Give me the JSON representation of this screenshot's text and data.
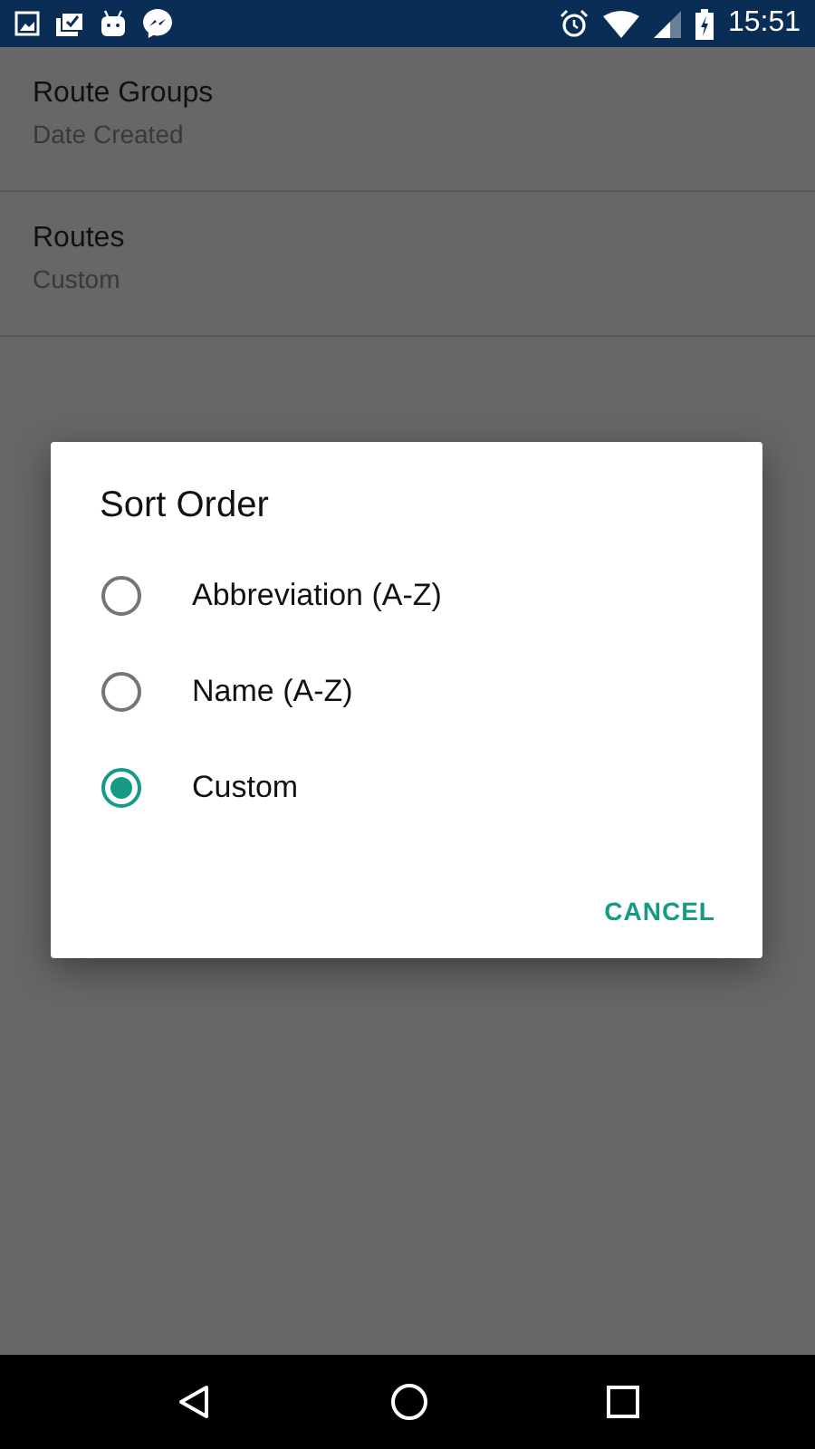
{
  "status_bar": {
    "time": "15:51"
  },
  "settings": [
    {
      "title": "Route Groups",
      "value": "Date Created"
    },
    {
      "title": "Routes",
      "value": "Custom"
    }
  ],
  "dialog": {
    "title": "Sort Order",
    "options": [
      {
        "label": "Abbreviation (A-Z)",
        "selected": false
      },
      {
        "label": "Name (A-Z)",
        "selected": false
      },
      {
        "label": "Custom",
        "selected": true
      }
    ],
    "buttons": [
      "CANCEL"
    ]
  }
}
